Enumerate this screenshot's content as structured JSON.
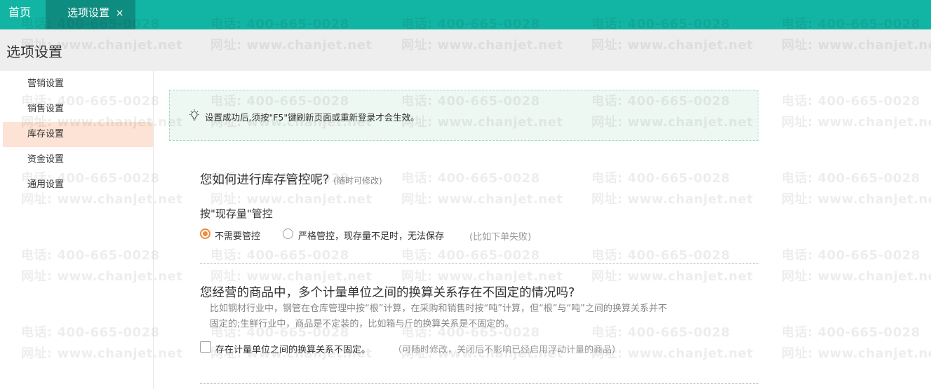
{
  "tabs": {
    "home": "首页",
    "active": "选项设置",
    "close": "×"
  },
  "page": {
    "title": "选项设置"
  },
  "sidebar": {
    "items": [
      {
        "label": "营销设置"
      },
      {
        "label": "销售设置"
      },
      {
        "label": "库存设置",
        "active": true
      },
      {
        "label": "资金设置"
      },
      {
        "label": "通用设置"
      }
    ]
  },
  "notice": {
    "icon": "lightbulb-icon",
    "text": "设置成功后,须按\"F5\"键刷新页面或重新登录才会生效。"
  },
  "inventory": {
    "question": "您如何进行库存管控呢?",
    "hint": "(随时可修改)",
    "sub_label": "按\"现存量\"管控",
    "option_none": "不需要管控",
    "option_strict": "严格管控，现存量不足时，无法保存",
    "option_strict_hint": "(比如下单失败)",
    "selected": "不需要管控"
  },
  "units": {
    "question": "您经营的商品中，多个计量单位之间的换算关系存在不固定的情况吗?",
    "desc_line1": "比如钢材行业中，钢管在仓库管理中按“根”计算，在采购和销售时按“吨”计算，但“根”与“吨”之间的换算关系并不",
    "desc_line2": "固定的;生鲜行业中，商品是不定装的，比如箱与斤的换算关系是不固定的。",
    "checkbox_label": "存在计量单位之间的换算关系不固定。",
    "checkbox_hint": "（可随时修改，关闭后不影响已经启用浮动计量的商品）",
    "checked": false
  },
  "watermark": {
    "phone": "电话: 400-665-0028",
    "site": "网址: www.chanjet.net"
  },
  "colors": {
    "topbar": "#12b5a3",
    "active_tab": "#0f8c80",
    "accent": "#f08a3a",
    "active_side": "#fde3d6"
  }
}
